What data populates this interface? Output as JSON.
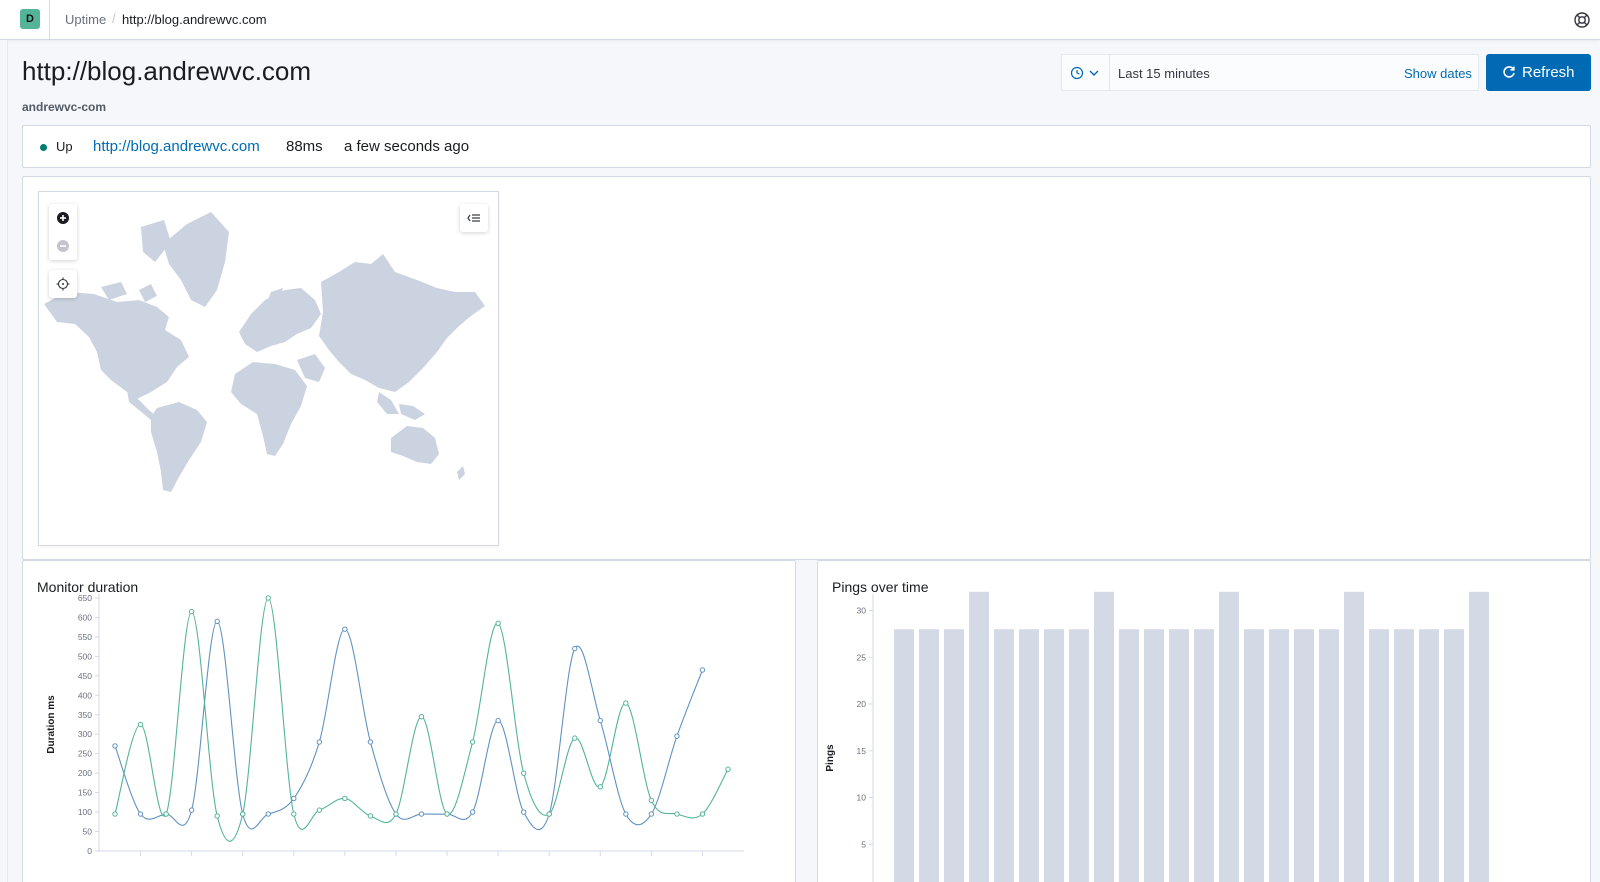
{
  "header": {
    "app_badge": "D",
    "breadcrumbs": [
      "Uptime",
      "http://blog.andrewvc.com"
    ],
    "separator": "/"
  },
  "page": {
    "title": "http://blog.andrewvc.com",
    "subtitle": "andrewvc-com"
  },
  "date_picker": {
    "range_label": "Last 15 minutes",
    "show_dates_label": "Show dates",
    "refresh_label": "Refresh"
  },
  "status": {
    "state": "Up",
    "url": "http://blog.andrewvc.com",
    "duration": "88ms",
    "checked": "a few seconds ago",
    "color_up": "#017d73"
  },
  "icons": [
    "app-badge",
    "help-icon",
    "clock-icon",
    "chevron-down-icon",
    "refresh-icon",
    "zoom-in-icon",
    "zoom-out-icon",
    "fit-to-data-icon",
    "layers-legend-icon"
  ],
  "chart_data": [
    {
      "type": "line",
      "title": "Monitor duration",
      "ylabel": "Duration ms",
      "xlabel": "",
      "ylim": [
        0,
        650
      ],
      "yticks": [
        0,
        50,
        100,
        150,
        200,
        250,
        300,
        350,
        400,
        450,
        500,
        550,
        600,
        650
      ],
      "x": [
        0,
        1,
        2,
        3,
        4,
        5,
        6,
        7,
        8,
        9,
        10,
        11,
        12,
        13,
        14,
        15,
        16,
        17,
        18,
        19,
        20,
        21,
        22,
        23,
        24
      ],
      "series": [
        {
          "color": "#6092c0",
          "values": [
            270,
            95,
            95,
            105,
            590,
            95,
            95,
            135,
            280,
            570,
            280,
            95,
            95,
            95,
            100,
            335,
            100,
            95,
            520,
            335,
            95,
            95,
            295,
            465,
            null
          ]
        },
        {
          "color": "#54b399",
          "values": [
            95,
            325,
            95,
            615,
            90,
            95,
            650,
            95,
            105,
            135,
            90,
            95,
            345,
            95,
            280,
            585,
            200,
            95,
            290,
            165,
            380,
            130,
            95,
            95,
            210
          ]
        }
      ],
      "grid": false,
      "legend": "none"
    },
    {
      "type": "bar",
      "title": "Pings over time",
      "ylabel": "Pings",
      "xlabel": "",
      "ylim": [
        0,
        32
      ],
      "yticks": [
        5,
        10,
        15,
        20,
        25,
        30
      ],
      "values": [
        28,
        28,
        28,
        32,
        28,
        28,
        28,
        28,
        32,
        28,
        28,
        28,
        28,
        32,
        28,
        28,
        28,
        28,
        32,
        28,
        28,
        28,
        28,
        32,
        0.5
      ],
      "color": "#d3dae6",
      "grid": false,
      "legend": "none"
    }
  ]
}
